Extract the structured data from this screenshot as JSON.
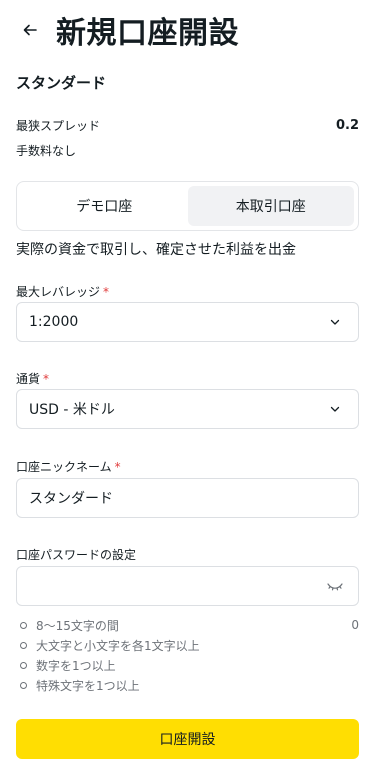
{
  "header": {
    "title": "新規口座開設",
    "back_icon": "arrow-left-icon"
  },
  "account": {
    "type_label": "スタンダード",
    "specs": [
      {
        "label": "最狭スプレッド",
        "value": "0.2"
      },
      {
        "label": "手数料なし",
        "value": ""
      }
    ]
  },
  "mode_tabs": {
    "tabs": [
      {
        "label": "デモ口座",
        "active": false
      },
      {
        "label": "本取引口座",
        "active": true
      }
    ],
    "description": "実際の資金で取引し、確定させた利益を出金"
  },
  "form": {
    "leverage": {
      "label": "最大レバレッジ",
      "required": "*",
      "value": "1:2000",
      "icon": "chevron-down-icon"
    },
    "currency": {
      "label": "通貨",
      "required": "*",
      "value": "USD - 米ドル",
      "icon": "chevron-down-icon"
    },
    "nickname": {
      "label": "口座ニックネーム",
      "required": "*",
      "value": "スタンダード"
    },
    "password": {
      "label": "口座パスワードの設定",
      "value": "",
      "placeholder": "",
      "icon": "eye-closed-icon",
      "char_count": "0",
      "rules": [
        "8～15文字の間",
        "大文字と小文字を各1文字以上",
        "数字を1つ以上",
        "特殊文字を1つ以上"
      ]
    }
  },
  "submit_label": "口座開設",
  "colors": {
    "accent": "#ffde02",
    "required": "#e03b3b",
    "text": "#141d22",
    "muted": "#6d7278",
    "border": "#dcdfe3"
  }
}
